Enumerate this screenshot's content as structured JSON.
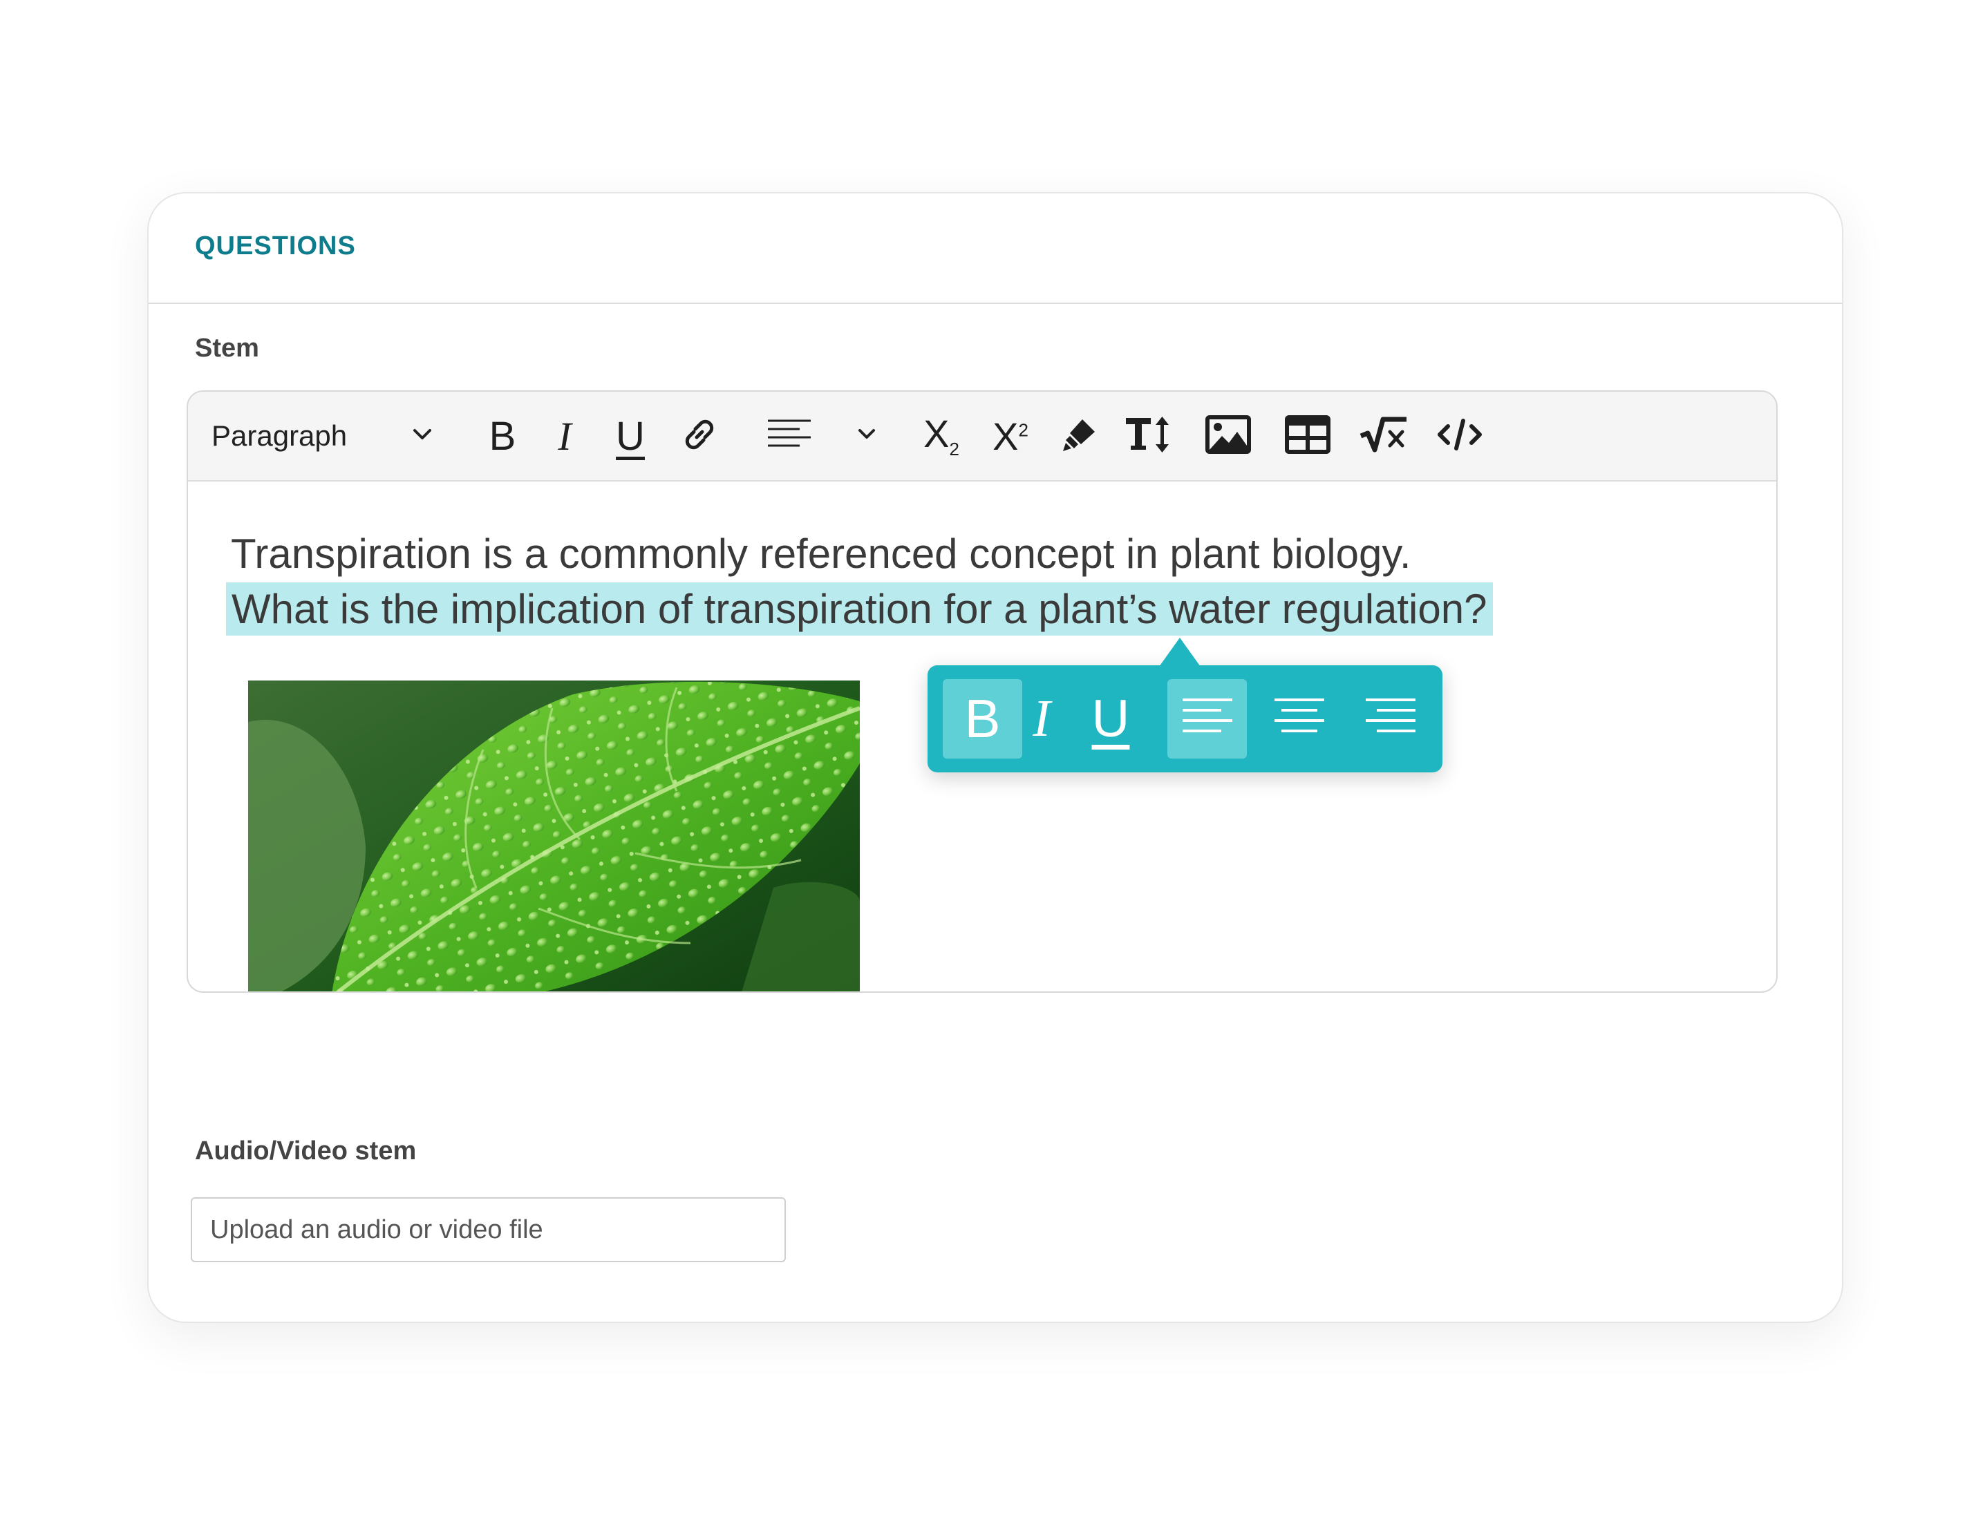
{
  "header": {
    "title": "QUESTIONS"
  },
  "stem": {
    "label": "Stem",
    "toolbar": {
      "paragraph_label": "Paragraph",
      "bold": "B",
      "italic": "I",
      "underline": "U",
      "subscript_base": "X",
      "subscript_index": "2",
      "superscript_base": "X",
      "superscript_index": "2",
      "icons": [
        "chevron-down-icon",
        "bold-icon",
        "italic-icon",
        "underline-icon",
        "link-icon",
        "align-left-icon",
        "chevron-down-icon",
        "subscript-icon",
        "superscript-icon",
        "highlighter-icon",
        "text-size-icon",
        "image-icon",
        "table-icon",
        "math-formula-icon",
        "code-icon"
      ]
    },
    "content": {
      "line1": "Transpiration is a commonly referenced concept in plant biology.",
      "line2": "What is the implication of transpiration for a plant’s water regulation?"
    },
    "popover": {
      "bold": "B",
      "italic": "I",
      "underline": "U",
      "icons": [
        "bold-icon",
        "italic-icon",
        "underline-icon",
        "align-left-icon",
        "align-center-icon",
        "align-right-icon"
      ],
      "active": [
        "bold",
        "align-left"
      ]
    }
  },
  "audio_video": {
    "label": "Audio/Video stem",
    "placeholder": "Upload an audio or video file"
  },
  "colors": {
    "accent": "#0e7c8c",
    "highlight": "#b9eaed",
    "popover": "#1fb6c2",
    "popover_active": "#5fd0d6"
  }
}
